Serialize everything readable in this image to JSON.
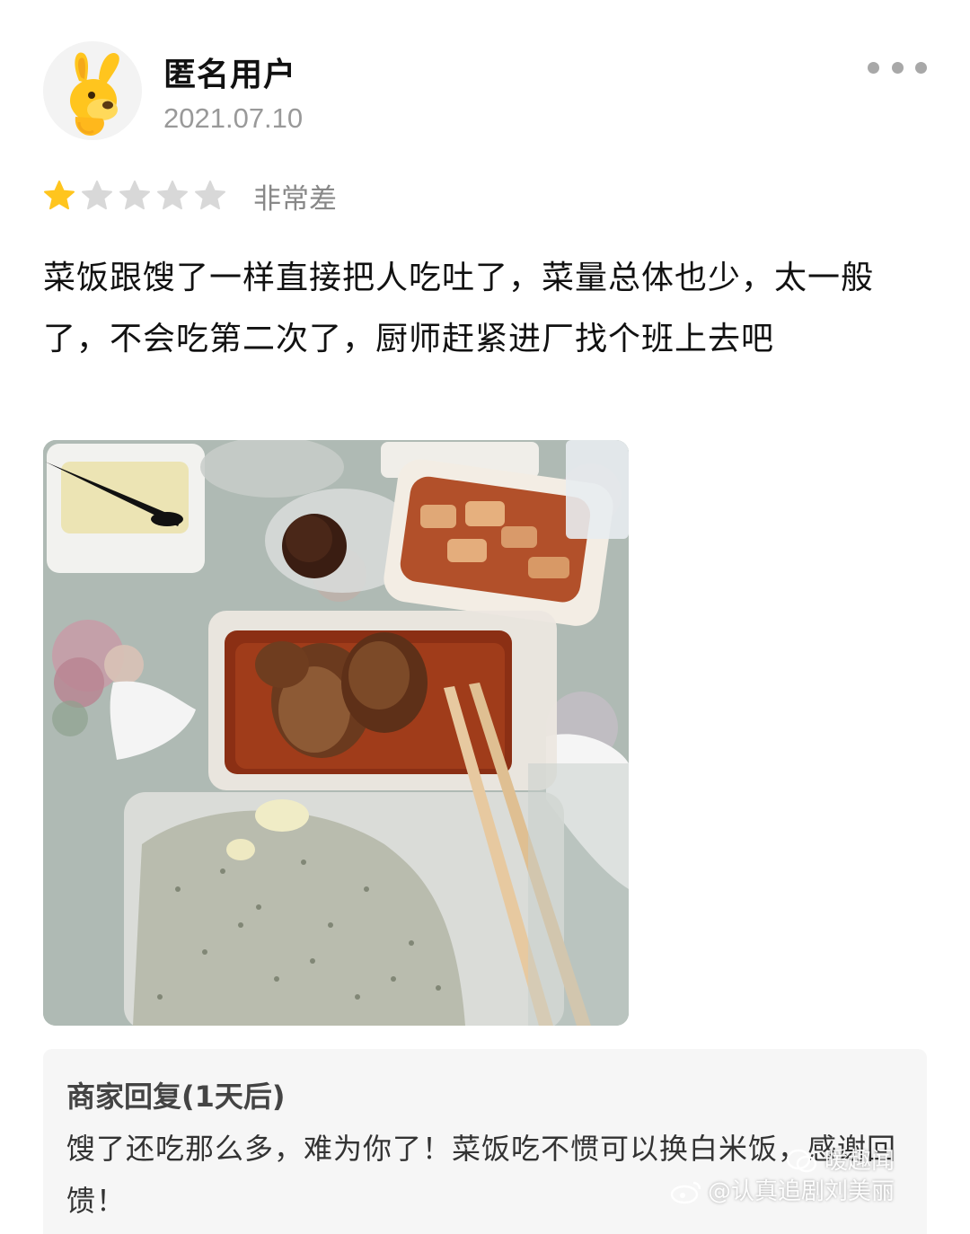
{
  "user": {
    "name": "匿名用户",
    "date": "2021.07.10",
    "avatar_icon": "yellow-dog-mascot"
  },
  "rating": {
    "stars": 1,
    "max_stars": 5,
    "label": "非常差",
    "filled_color": "#FFC51E",
    "empty_color": "#D8D8D8"
  },
  "review": {
    "text": "菜饭跟馊了一样直接把人吃吐了，菜量总体也少，太一般了，不会吃第二次了，厨师赶紧进厂找个班上去吧"
  },
  "photo": {
    "subject": "takeout-food-photo"
  },
  "merchant_reply": {
    "title": "商家回复(1天后)",
    "text": "馊了还吃那么多，难为你了！菜饭吃不惯可以换白米饭，感谢回馈！"
  },
  "watermark": {
    "line1": "暖趣闻",
    "line2": "@认真追剧刘美丽"
  }
}
